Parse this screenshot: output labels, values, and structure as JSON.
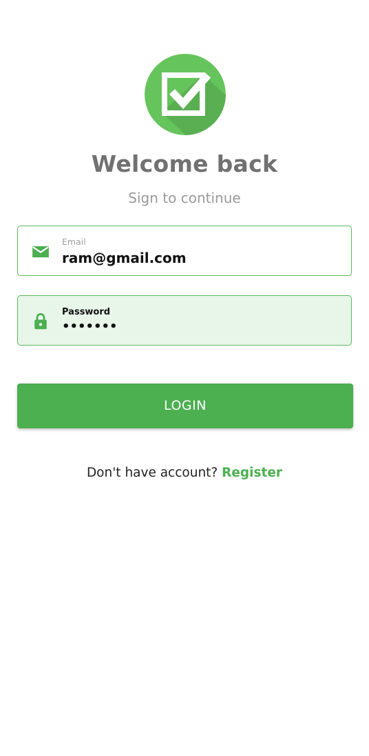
{
  "header": {
    "logo_icon": "checkbox-check-icon",
    "title": "Welcome back",
    "subtitle": "Sign to continue"
  },
  "form": {
    "email": {
      "icon": "mail-icon",
      "label": "Email",
      "value": "ram@gmail.com"
    },
    "password": {
      "icon": "lock-icon",
      "label": "Password",
      "value": "•••••••"
    },
    "login_label": "LOGIN"
  },
  "footer": {
    "prompt": "Don't have account?",
    "register_label": "Register"
  },
  "colors": {
    "accent": "#4caf50",
    "logo_light": "#66c45c",
    "logo_shadow": "#4e9f49",
    "title": "#717171",
    "subtitle": "#9a9a9a",
    "password_bg": "#e8f5e9"
  }
}
